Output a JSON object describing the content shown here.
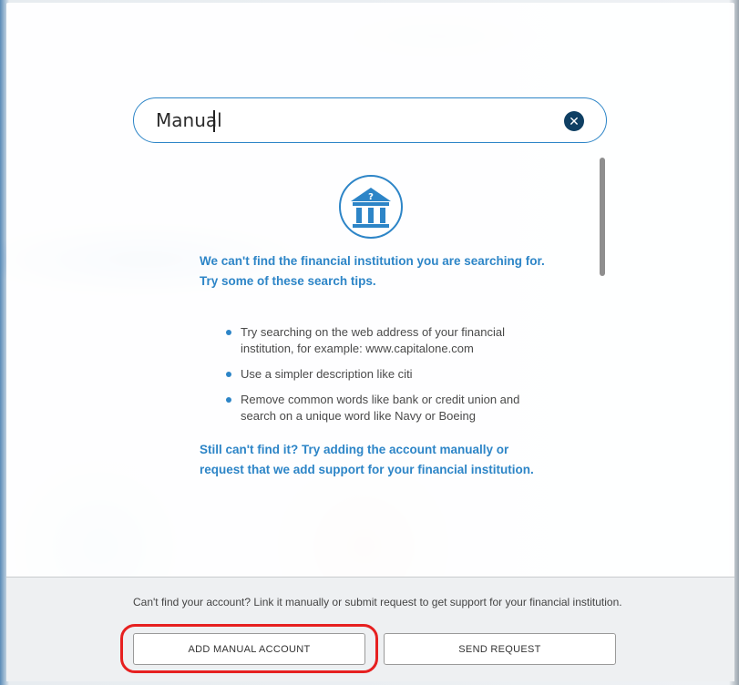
{
  "search": {
    "value": "Manual",
    "clear_icon": "clear-x-icon"
  },
  "icons": {
    "bank": "bank-question-icon"
  },
  "no_results": {
    "heading": "We can't find the financial institution you are searching for. Try some of these search tips.",
    "tips": [
      "Try searching on the web address of your financial institution, for example: www.capitalone.com",
      "Use a simpler description like citi",
      "Remove common words like bank or credit union and search on a unique word like Navy or Boeing"
    ],
    "still_cant_find": "Still can't find it? Try adding the account manually or request that we add support for your financial institution."
  },
  "footer": {
    "text": "Can't find your account? Link it manually or submit request to get support for your financial institution.",
    "add_manual_label": "ADD MANUAL ACCOUNT",
    "send_request_label": "SEND REQUEST"
  },
  "colors": {
    "accent": "#2d85c7",
    "icon_dark": "#0f3f63",
    "highlight": "#e62020"
  }
}
